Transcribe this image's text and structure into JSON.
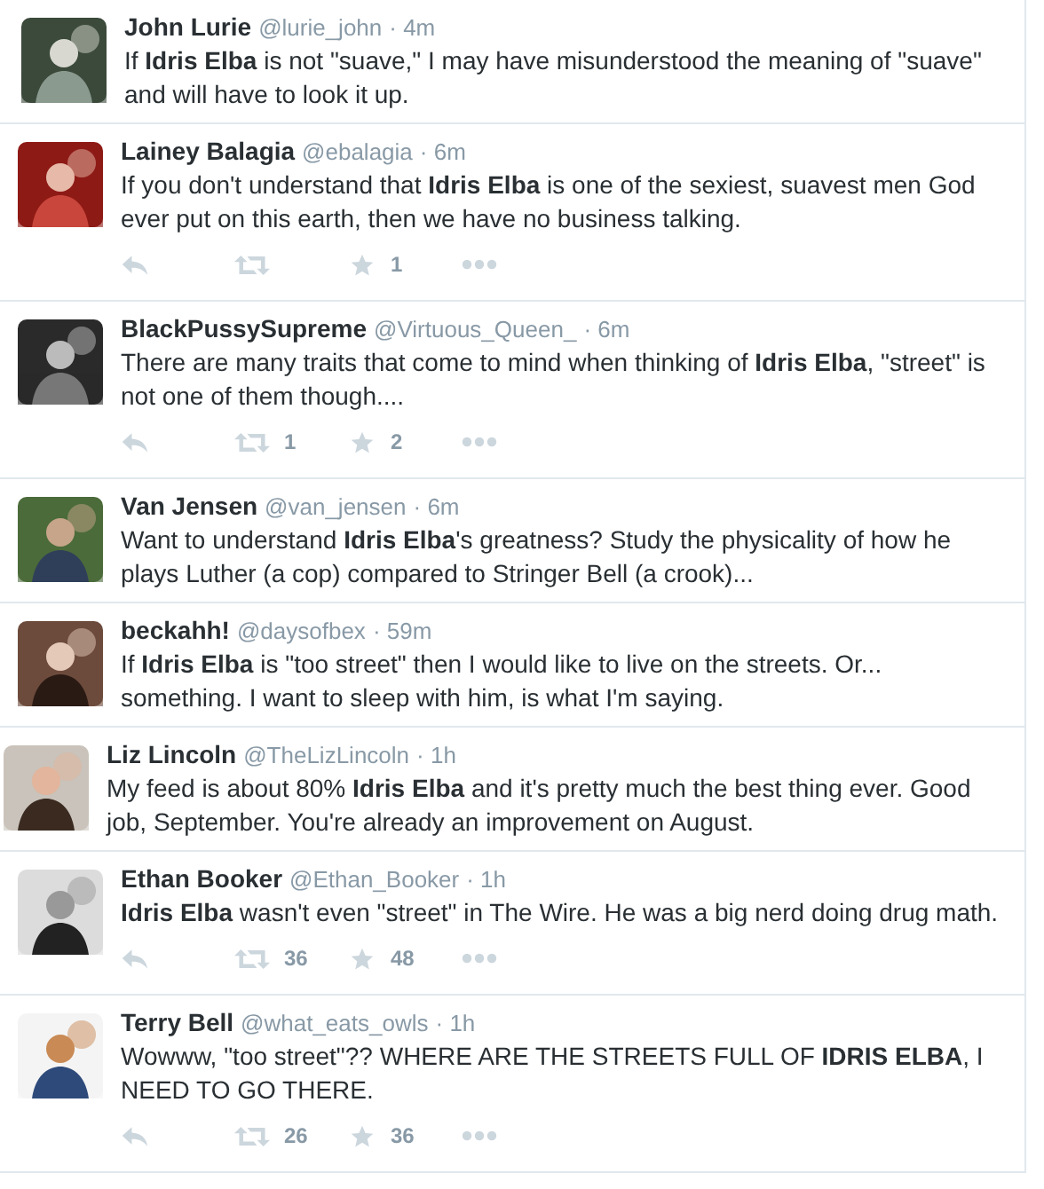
{
  "tweets": [
    {
      "name": "John Lurie",
      "handle": "@lurie_john",
      "time": "· 4m",
      "text": "If **Idris Elba** is not \"suave,\" I may have misunderstood the meaning of \"suave\" and will have to look it up."
    },
    {
      "name": "Lainey Balagia",
      "handle": "@ebalagia",
      "time": "· 6m",
      "text": "If you don't understand that **Idris Elba** is one of the sexiest, suavest men God ever put on this earth, then we have no business talking.",
      "actions": {
        "favorites": "1"
      }
    },
    {
      "name": "BlackPussySupreme",
      "handle": "@Virtuous_Queen_",
      "time": "· 6m",
      "text": "There are many traits that come to mind when thinking of **Idris Elba**, \"street\" is not one of them though....",
      "actions": {
        "retweets": "1",
        "favorites": "2"
      }
    },
    {
      "name": "Van Jensen",
      "handle": "@van_jensen",
      "time": "· 6m",
      "text": "Want to understand **Idris Elba**'s greatness? Study the physicality of how he plays Luther (a cop) compared to Stringer Bell (a crook)..."
    },
    {
      "name": "beckahh!",
      "handle": "@daysofbex",
      "time": "· 59m",
      "text": "If **Idris Elba** is \"too street\" then I would like to live on the streets. Or... something. I want to sleep with him, is what I'm saying."
    },
    {
      "name": "Liz Lincoln",
      "handle": "@TheLizLincoln",
      "time": "· 1h",
      "text": "My feed is about 80% **Idris Elba** and it's pretty much the best thing ever. Good job, September. You're already an improvement on August."
    },
    {
      "name": "Ethan Booker",
      "handle": "@Ethan_Booker",
      "time": "· 1h",
      "text": "**Idris Elba** wasn't even \"street\" in The Wire. He was a big nerd doing drug math.",
      "actions": {
        "retweets": "36",
        "favorites": "48"
      }
    },
    {
      "name": "Terry Bell",
      "handle": "@what_eats_owls",
      "time": "· 1h",
      "text": "Wowww, \"too street\"?? WHERE ARE THE STREETS FULL OF **IDRIS ELBA**, I NEED TO GO THERE.",
      "actions": {
        "retweets": "26",
        "favorites": "36"
      }
    }
  ]
}
